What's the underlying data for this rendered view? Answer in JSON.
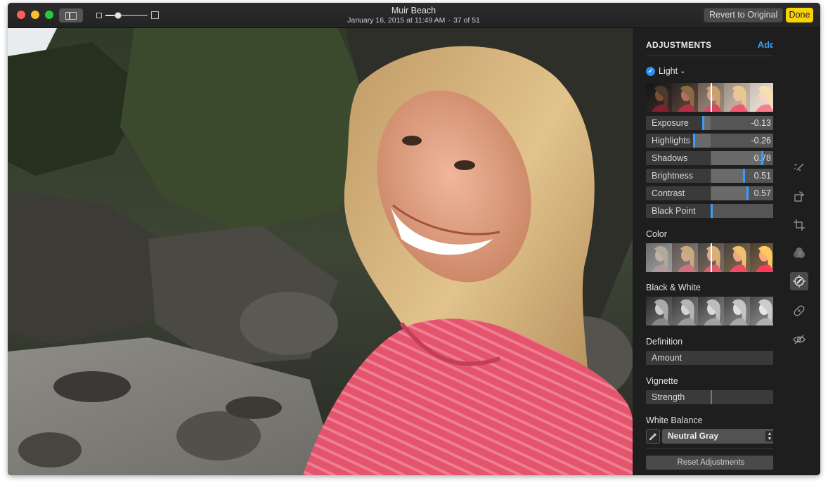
{
  "window": {
    "title": "Muir Beach",
    "date": "January 16, 2015 at 11:49 AM",
    "separator": "·",
    "counter": "37 of 51"
  },
  "toolbar": {
    "revert_label": "Revert to Original",
    "done_label": "Done",
    "zoom_level": 0.3
  },
  "panel": {
    "title": "ADJUSTMENTS",
    "add_label": "Add",
    "light": {
      "label": "Light",
      "chevron": "⌄",
      "checked": true,
      "strip_marker": 0.5,
      "sliders": [
        {
          "label": "Exposure",
          "value": "-0.13",
          "position": 0.44
        },
        {
          "label": "Highlights",
          "value": "-0.26",
          "position": 0.37
        },
        {
          "label": "Shadows",
          "value": "0.78",
          "position": 0.89
        },
        {
          "label": "Brightness",
          "value": "0.51",
          "position": 0.75
        },
        {
          "label": "Contrast",
          "value": "0.57",
          "position": 0.78
        },
        {
          "label": "Black Point",
          "value": "",
          "position": 0.5
        }
      ]
    },
    "color": {
      "label": "Color",
      "strip_marker": 0.5
    },
    "black_white": {
      "label": "Black & White"
    },
    "definition": {
      "label": "Definition",
      "slider_label": "Amount"
    },
    "vignette": {
      "label": "Vignette",
      "slider_label": "Strength",
      "position": 0.5
    },
    "white_balance": {
      "label": "White Balance",
      "selected": "Neutral Gray"
    },
    "reset_label": "Reset Adjustments"
  },
  "tools": [
    {
      "icon": "magic-wand-icon",
      "active": false
    },
    {
      "icon": "rotate-icon",
      "active": false
    },
    {
      "icon": "crop-icon",
      "active": false
    },
    {
      "icon": "filters-icon",
      "active": false
    },
    {
      "icon": "adjust-icon",
      "active": true
    },
    {
      "icon": "retouch-icon",
      "active": false
    },
    {
      "icon": "red-eye-icon",
      "active": false
    }
  ],
  "colors": {
    "accent": "#3a9df5",
    "done": "#f5d20b",
    "marker": "#3b9bff"
  }
}
